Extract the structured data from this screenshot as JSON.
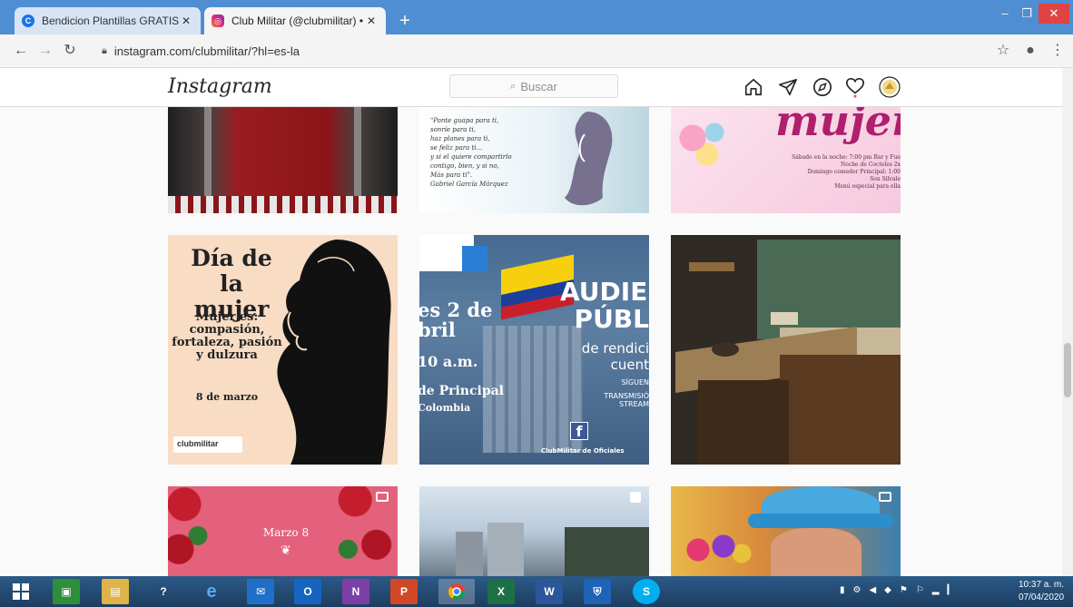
{
  "browser": {
    "tabs": [
      {
        "title": "Bendicion Plantillas GRATIS - Pla",
        "close": "✕",
        "active": false
      },
      {
        "title": "Club Militar (@clubmilitar) • Foto",
        "close": "✕",
        "active": true
      }
    ],
    "new_tab": "+",
    "url": "instagram.com/clubmilitar/?hl=es-la"
  },
  "instagram": {
    "logo": "Instagram",
    "search_placeholder": "Buscar"
  },
  "posts": {
    "row1": {
      "poem": [
        "\"Ponte guapa para ti,",
        "sonríe para ti,",
        "haz planes para ti,",
        "se feliz para ti...",
        "y si el quiere compartirlo",
        "contigo, bien, y si no,",
        "Más para ti\".",
        "Gabriel García Márquez"
      ],
      "mujer_title": "mujer",
      "mujer_lines": [
        "Sábado en la noche: 7:00 pm Bar y Fue",
        "Noche de Cocteles 2x",
        "Domingo comedor Principal: 1:00",
        "Son Silvale",
        "Menú especial para ella"
      ]
    },
    "row2": {
      "dia_title": [
        "Día de la",
        "mujer"
      ],
      "dia_sub": [
        "Mujer es:",
        "compasión,",
        "fortaleza, pasión",
        "y dulzura"
      ],
      "dia_date": "8 de marzo",
      "dia_brand": "clubmilitar",
      "aud_left": [
        "es 2 de",
        "bril",
        "10 a.m.",
        "de Principal",
        "Colombia"
      ],
      "aud_right": [
        "AUDIEN",
        "PÚBL",
        "de rendici",
        "cuent",
        "SÍGUEN",
        "TRANSMISIÓ",
        "STREAM"
      ],
      "aud_footer": "ClubMilitar de Oficiales",
      "aud_fb": "f"
    },
    "row3": {
      "marzo": "Marzo 8"
    }
  },
  "taskbar": {
    "time": "10:37 a. m.",
    "date": "07/04/2020"
  },
  "colors": {
    "tabstrip": "#4f8ed3",
    "instagram_text": "#262626"
  }
}
